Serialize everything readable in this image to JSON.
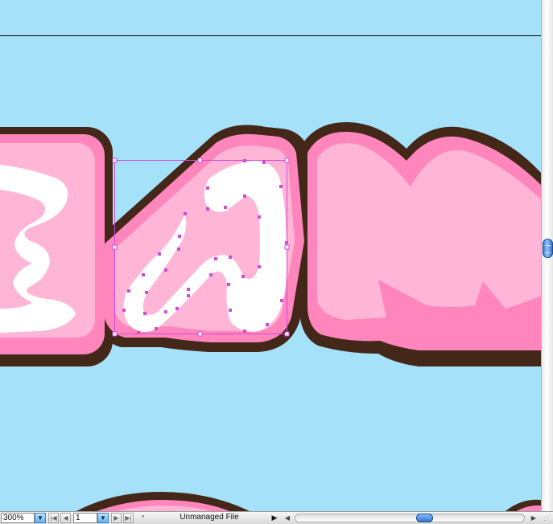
{
  "colors": {
    "background": "#a5e1f9",
    "outline": "#432718",
    "pink_dark": "#ff86bc",
    "pink_light": "#ffb5d6",
    "highlight": "#ffffff",
    "selection": "#d24ad8"
  },
  "statusbar": {
    "zoom": "300%",
    "zoom_dropdown_icon": "▼",
    "first_page_icon": "|◀",
    "prev_page_icon": "◀",
    "page_number": "1",
    "page_dropdown_icon": "▼",
    "next_page_icon": "▶",
    "last_page_icon": "▶|",
    "status_icon": "◔",
    "status_text": "Unmanaged File",
    "status_arrow_icon": "▶"
  },
  "scroll": {
    "left_icon": "◀",
    "right_icon": "▶",
    "grow_icon": "⋰"
  }
}
